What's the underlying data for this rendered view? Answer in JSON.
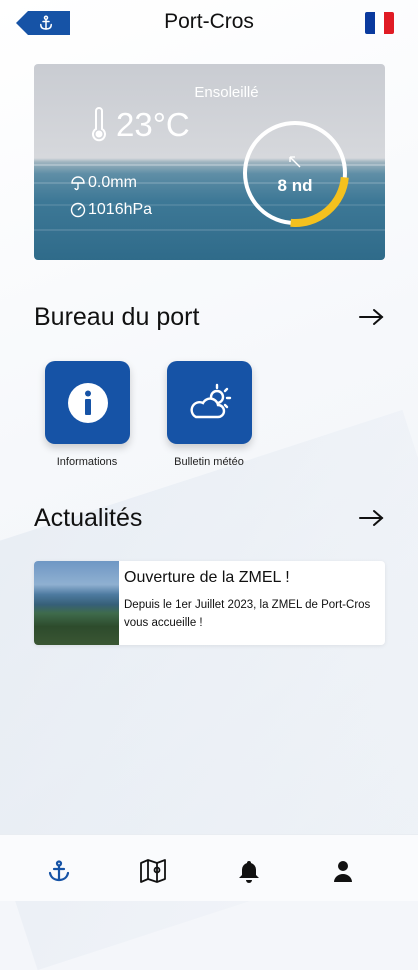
{
  "header": {
    "title": "Port-Cros",
    "back_icon": "anchor-icon",
    "flag": {
      "colors": [
        "#0a3a9e",
        "#ffffff",
        "#e01b24"
      ],
      "icon": "france-flag-icon"
    }
  },
  "weather": {
    "condition": "Ensoleillé",
    "temperature": "23°C",
    "rain": "0.0mm",
    "pressure": "1016hPa",
    "wind": "8 nd",
    "wind_gauge_fraction": 0.25,
    "gauge_color": "#f4c11e"
  },
  "harbour_office": {
    "title": "Bureau du port",
    "tiles": [
      {
        "label": "Informations",
        "icon": "info-icon"
      },
      {
        "label": "Bulletin météo",
        "icon": "weather-cloud-sun-icon"
      }
    ]
  },
  "news": {
    "title": "Actualités",
    "items": [
      {
        "title": "Ouverture de la ZMEL !",
        "body": "Depuis le 1er Juillet 2023, la ZMEL de Port-Cros vous accueille !"
      }
    ]
  },
  "nav": {
    "items": [
      {
        "icon": "anchor-icon",
        "active": true
      },
      {
        "icon": "map-icon",
        "active": false
      },
      {
        "icon": "bell-icon",
        "active": false
      },
      {
        "icon": "user-icon",
        "active": false
      }
    ],
    "accent": "#1653a6"
  }
}
